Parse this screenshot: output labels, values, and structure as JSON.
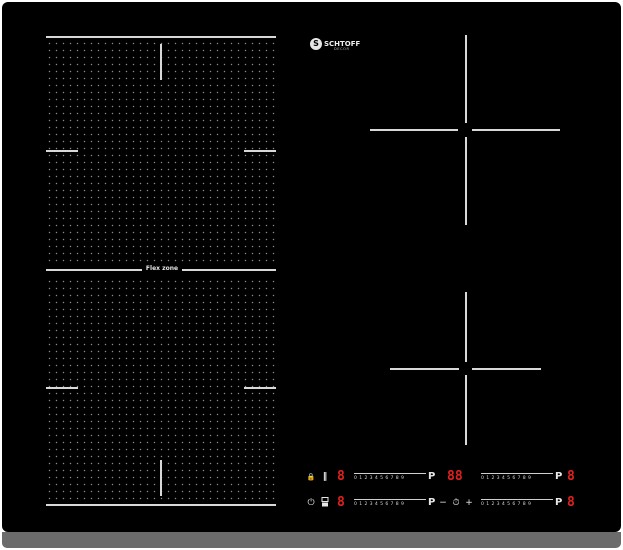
{
  "brand": {
    "name": "SCHTOFF",
    "tagline": "DECOR"
  },
  "flex_zone": {
    "label": "Flex zone"
  },
  "controls": {
    "lock_symbol": "🔒",
    "pause_symbol": "‖",
    "power_symbol": "⏻",
    "timer_symbol": "⏱",
    "minus_symbol": "−",
    "plus_symbol": "+",
    "boost_symbol": "P",
    "slider_scale": "0123456789",
    "zone_display_1": "8",
    "zone_display_2": "8",
    "zone_display_3": "8",
    "zone_display_4": "8",
    "timer_display": "88"
  }
}
